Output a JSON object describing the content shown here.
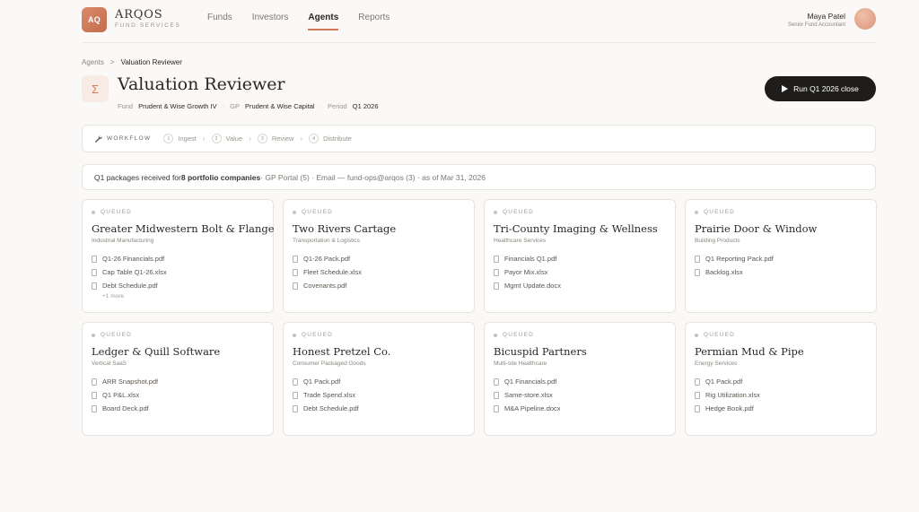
{
  "brand": {
    "logo": "AQ",
    "name": "ARQOS",
    "subtitle": "FUND SERVICES"
  },
  "nav": [
    {
      "label": "Funds",
      "active": false
    },
    {
      "label": "Investors",
      "active": false
    },
    {
      "label": "Agents",
      "active": true
    },
    {
      "label": "Reports",
      "active": false
    }
  ],
  "user": {
    "name": "Maya Patel",
    "role": "Senior Fund Accountant"
  },
  "breadcrumb": {
    "parent": "Agents",
    "separator": ">",
    "current": "Valuation Reviewer"
  },
  "page": {
    "icon": "Σ",
    "title": "Valuation Reviewer",
    "fund_label": "Fund",
    "fund_value": "Prudent & Wise Growth IV",
    "gp_label": "GP",
    "gp_value": "Prudent & Wise Capital",
    "period_label": "Period",
    "period_value": "Q1 2026"
  },
  "run_button": {
    "label": "Run Q1 2026 close"
  },
  "workflow": {
    "label": "WORKFLOW",
    "steps": [
      {
        "num": "1",
        "label": "Ingest"
      },
      {
        "num": "2",
        "label": "Value"
      },
      {
        "num": "3",
        "label": "Review"
      },
      {
        "num": "4",
        "label": "Distribute"
      }
    ]
  },
  "info": {
    "prefix": "Q1 packages received for ",
    "count": "8 portfolio companies",
    "sources": " · GP Portal (5) · Email — fund-ops@arqos (3) · as of Mar 31, 2026"
  },
  "companies": [
    {
      "status": "QUEUED",
      "name": "Greater Midwestern Bolt & Flange",
      "industry": "Industrial Manufacturing",
      "files": [
        "Q1-26 Financials.pdf",
        "Cap Table Q1-26.xlsx",
        "Debt Schedule.pdf"
      ],
      "more": "+1 more"
    },
    {
      "status": "QUEUED",
      "name": "Two Rivers Cartage",
      "industry": "Transportation & Logistics",
      "files": [
        "Q1-26 Pack.pdf",
        "Fleet Schedule.xlsx",
        "Covenants.pdf"
      ],
      "more": ""
    },
    {
      "status": "QUEUED",
      "name": "Tri-County Imaging & Wellness",
      "industry": "Healthcare Services",
      "files": [
        "Financials Q1.pdf",
        "Payor Mix.xlsx",
        "Mgmt Update.docx"
      ],
      "more": ""
    },
    {
      "status": "QUEUED",
      "name": "Prairie Door & Window",
      "industry": "Building Products",
      "files": [
        "Q1 Reporting Pack.pdf",
        "Backlog.xlsx"
      ],
      "more": ""
    },
    {
      "status": "QUEUED",
      "name": "Ledger & Quill Software",
      "industry": "Vertical SaaS",
      "files": [
        "ARR Snapshot.pdf",
        "Q1 P&L.xlsx",
        "Board Deck.pdf"
      ],
      "more": ""
    },
    {
      "status": "QUEUED",
      "name": "Honest Pretzel Co.",
      "industry": "Consumer Packaged Goods",
      "files": [
        "Q1 Pack.pdf",
        "Trade Spend.xlsx",
        "Debt Schedule.pdf"
      ],
      "more": ""
    },
    {
      "status": "QUEUED",
      "name": "Bicuspid Partners",
      "industry": "Multi-site Healthcare",
      "files": [
        "Q1 Financials.pdf",
        "Same-store.xlsx",
        "M&A Pipeline.docx"
      ],
      "more": ""
    },
    {
      "status": "QUEUED",
      "name": "Permian Mud & Pipe",
      "industry": "Energy Services",
      "files": [
        "Q1 Pack.pdf",
        "Rig Utilization.xlsx",
        "Hedge Book.pdf"
      ],
      "more": ""
    }
  ]
}
